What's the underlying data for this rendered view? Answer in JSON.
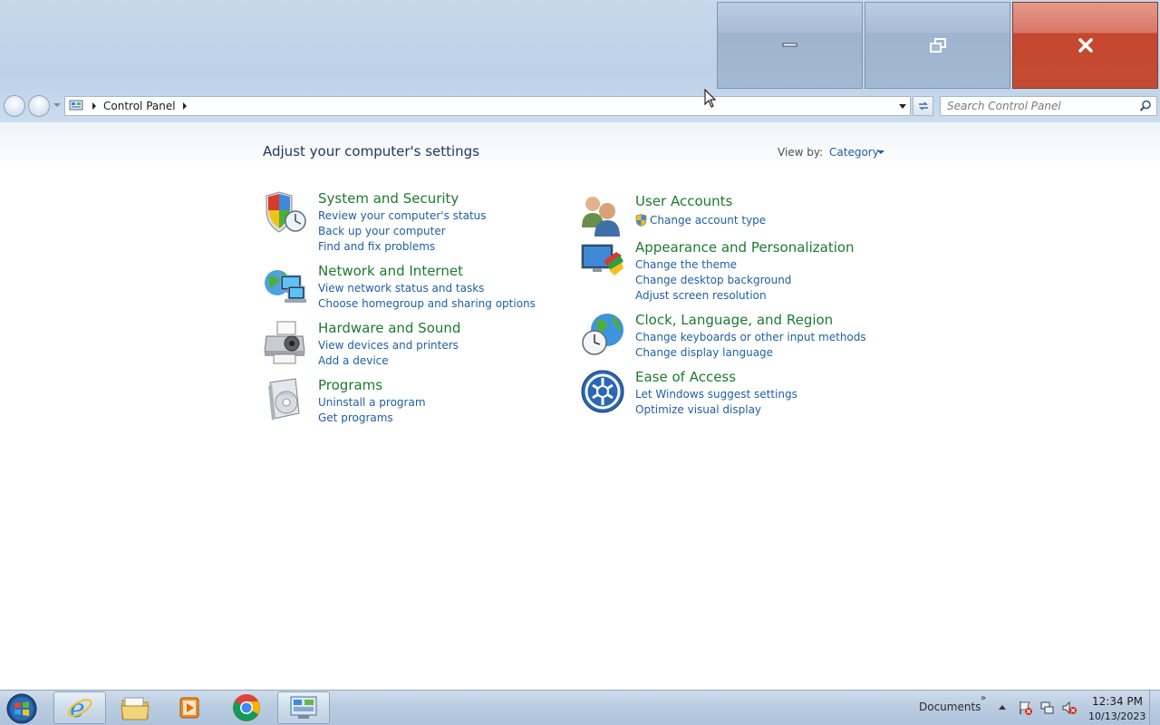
{
  "window": {
    "minimize_label": "minimize",
    "restore_label": "restore",
    "close_label": "close"
  },
  "address": {
    "breadcrumb": "Control Panel",
    "search_placeholder": "Search Control Panel"
  },
  "main": {
    "title": "Adjust your computer's settings",
    "view_by_label": "View by:",
    "view_by_value": "Category",
    "categories": [
      {
        "title": "System and Security",
        "links": [
          "Review your computer's status",
          "Back up your computer",
          "Find and fix problems"
        ],
        "icon": "shield-icon"
      },
      {
        "title": "Network and Internet",
        "links": [
          "View network status and tasks",
          "Choose homegroup and sharing options"
        ],
        "icon": "network-icon"
      },
      {
        "title": "Hardware and Sound",
        "links": [
          "View devices and printers",
          "Add a device"
        ],
        "icon": "printer-icon"
      },
      {
        "title": "Programs",
        "links": [
          "Uninstall a program",
          "Get programs"
        ],
        "icon": "programs-icon"
      },
      {
        "title": "User Accounts",
        "links": [
          "Change account type"
        ],
        "icon": "users-icon"
      },
      {
        "title": "Appearance and Personalization",
        "links": [
          "Change the theme",
          "Change desktop background",
          "Adjust screen resolution"
        ],
        "icon": "appearance-icon"
      },
      {
        "title": "Clock, Language, and Region",
        "links": [
          "Change keyboards or other input methods",
          "Change display language"
        ],
        "icon": "clock-globe-icon"
      },
      {
        "title": "Ease of Access",
        "links": [
          "Let Windows suggest settings",
          "Optimize visual display"
        ],
        "icon": "ease-of-access-icon"
      }
    ]
  },
  "taskbar": {
    "toolbar_label": "Documents",
    "time": "12:34 PM",
    "date": "10/13/2023"
  },
  "colors": {
    "category_title": "#1e7a2e",
    "link": "#1f5fa8",
    "close_button": "#c5472f"
  }
}
